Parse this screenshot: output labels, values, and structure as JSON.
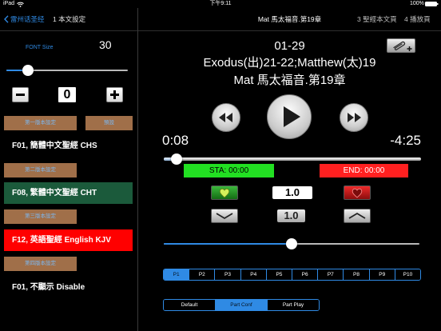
{
  "status_bar": {
    "device": "iPad",
    "time": "下午9:11",
    "battery": "100%"
  },
  "nav": {
    "back_label": "雷州话圣经",
    "settings_title": "1 本文設定",
    "title": "Mat 馬太福音.第19章",
    "tabs": [
      {
        "label": "3 聖經本文頁"
      },
      {
        "label": "4 播放頁"
      }
    ]
  },
  "settings": {
    "font_size_label": "FONT Size",
    "font_size_value": "30",
    "font_size_slider_level": 0.145,
    "stepper_value": "0",
    "preset_button": "預設",
    "versions": [
      {
        "button": "第一版本設定",
        "label": "F01, 簡體中文聖經 CHS"
      },
      {
        "button": "第二版本設定",
        "label": "F08, 繁體中文聖經 CHT",
        "highlight": "#1b5a3b"
      },
      {
        "button": "第三版本設定",
        "label": "F12, 英語聖經 English KJV",
        "highlight": "#ff0000"
      },
      {
        "button": "第四版本設定",
        "label": "F01, 不顯示 Disable"
      }
    ]
  },
  "player": {
    "verse_range": "01-29",
    "reading": "Exodus(出)21-22;Matthew(太)19",
    "chapter": "Mat 馬太福音.第19章",
    "elapsed": "0:08",
    "remaining": "-4:25",
    "progress_level": 0.03,
    "start_marker": "STA: 00:00",
    "end_marker": "END: 00:00",
    "speed_value": "1.0",
    "speed_step": "1.0",
    "volume_level": 0.5,
    "parts": {
      "items": [
        "P1",
        "P2",
        "P3",
        "P4",
        "P5",
        "P6",
        "P7",
        "P8",
        "P9",
        "P10"
      ],
      "selected_index": 0
    },
    "modes": {
      "items": [
        "Default",
        "Part Conf",
        "Part Play"
      ],
      "selected_index": 1
    }
  },
  "icons": {
    "status_wifi": "wifi-icon",
    "status_battery": "battery-icon",
    "back": "chevron-left-icon",
    "decrease": "minus-icon",
    "increase": "plus-icon",
    "attach": "paperclip-plus-icon",
    "rewind": "rewind-icon",
    "play": "play-icon",
    "forward": "fast-forward-icon",
    "mark_start": "pin-icon",
    "mark_end": "pin-icon",
    "speed_down": "chevron-down-icon",
    "speed_up": "chevron-up-icon"
  },
  "colors": {
    "accent": "#2f8ae4",
    "brown_button": "#a06f49",
    "brown_button_text": "#7db8f0",
    "start_marker": "#22e022",
    "end_marker": "#ff2020"
  }
}
